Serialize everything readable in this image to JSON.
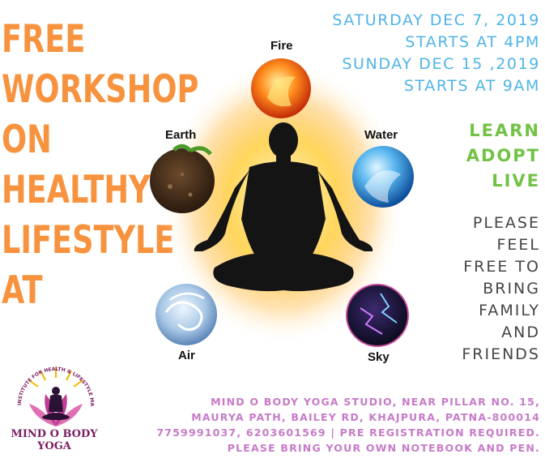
{
  "headline": [
    "FREE",
    "WORKSHOP",
    "ON",
    "HEALTHY",
    "LIFESTYLE",
    "AT"
  ],
  "schedule": [
    "SATURDAY DEC 7, 2019",
    "STARTS AT 4PM",
    "SUNDAY DEC 15 ,2019",
    "STARTS AT 9AM"
  ],
  "motto": [
    "LEARN",
    "ADOPT",
    "LIVE"
  ],
  "invite": [
    "PLEASE",
    "FEEL",
    "FREE TO",
    "BRING",
    "FAMILY",
    "AND",
    "FRIENDS"
  ],
  "elements": {
    "fire": "Fire",
    "earth": "Earth",
    "water": "Water",
    "air": "Air",
    "sky": "Sky"
  },
  "footer": [
    "MIND O BODY YOGA STUDIO, NEAR PILLAR NO. 15,",
    "MAURYA PATH, BAILEY RD, KHAJPURA, PATNA-800014",
    "7759991037, 6203601569 | PRE REGISTRATION REQUIRED.",
    "PLEASE BRING YOUR OWN NOTEBOOK AND PEN."
  ],
  "logo": {
    "arc_text": "INSTITUTE FOR HEALTH & LIFESTYLE MANAGEMENT",
    "name_line1": "MIND O BODY",
    "name_line2": "YOGA"
  },
  "colors": {
    "headline": "#f7933f",
    "schedule": "#4fb4e6",
    "motto": "#72c246",
    "invite": "#444444",
    "footer": "#c77ac9",
    "logo": "#7b1f63"
  }
}
